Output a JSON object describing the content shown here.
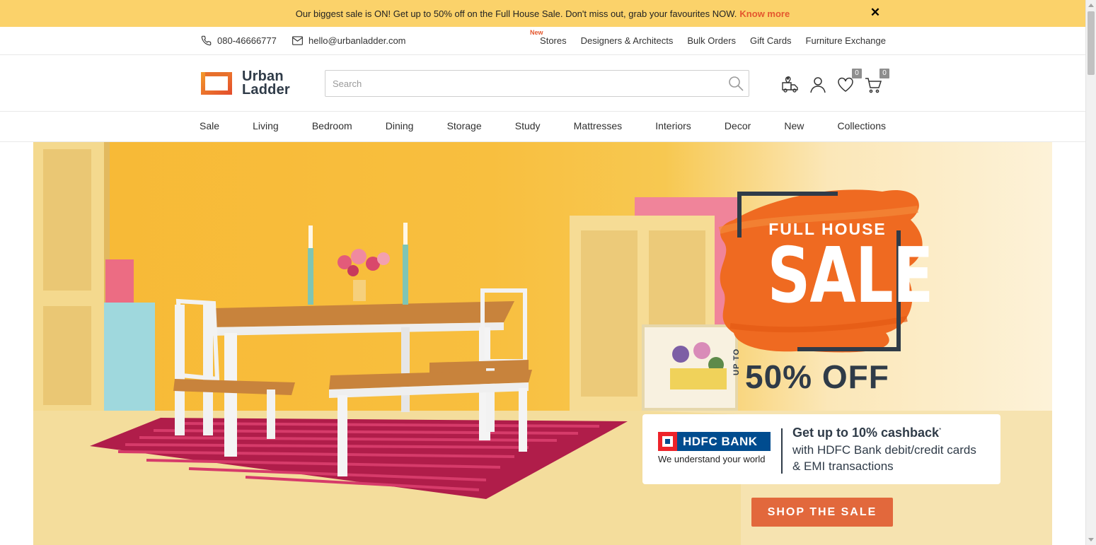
{
  "announcement": {
    "text": "Our biggest sale is ON! Get up to 50% off on the Full House Sale. Don't miss out, grab your favourites NOW.",
    "link": "Know more",
    "close": "✕"
  },
  "utility": {
    "phone": "080-46666777",
    "email": "hello@urbanladder.com",
    "new_tag": "New",
    "links": [
      "Stores",
      "Designers & Architects",
      "Bulk Orders",
      "Gift Cards",
      "Furniture Exchange"
    ]
  },
  "header": {
    "logo_line1": "Urban",
    "logo_line2": "Ladder",
    "search_placeholder": "Search",
    "wishlist_count": "0",
    "cart_count": "0"
  },
  "nav": {
    "items": [
      "Sale",
      "Living",
      "Bedroom",
      "Dining",
      "Storage",
      "Study",
      "Mattresses",
      "Interiors",
      "Decor",
      "New",
      "Collections"
    ]
  },
  "banner": {
    "title_top": "FULL HOUSE",
    "title_main": "SALE",
    "up_to": "UP TO",
    "discount": "50% OFF",
    "bank_name": "HDFC BANK",
    "bank_tagline": "We understand your world",
    "cashback_title": "Get up to 10% cashback",
    "cashback_mark": "*",
    "cashback_line1": "with HDFC Bank debit/credit cards",
    "cashback_line2": "& EMI transactions",
    "cta": "SHOP THE SALE"
  },
  "colors": {
    "announce_bg": "#fbd26a",
    "accent": "#e2683c",
    "brand_dark": "#2f3b48",
    "hdfc_blue": "#004c8f",
    "hdfc_red": "#ed232a"
  }
}
